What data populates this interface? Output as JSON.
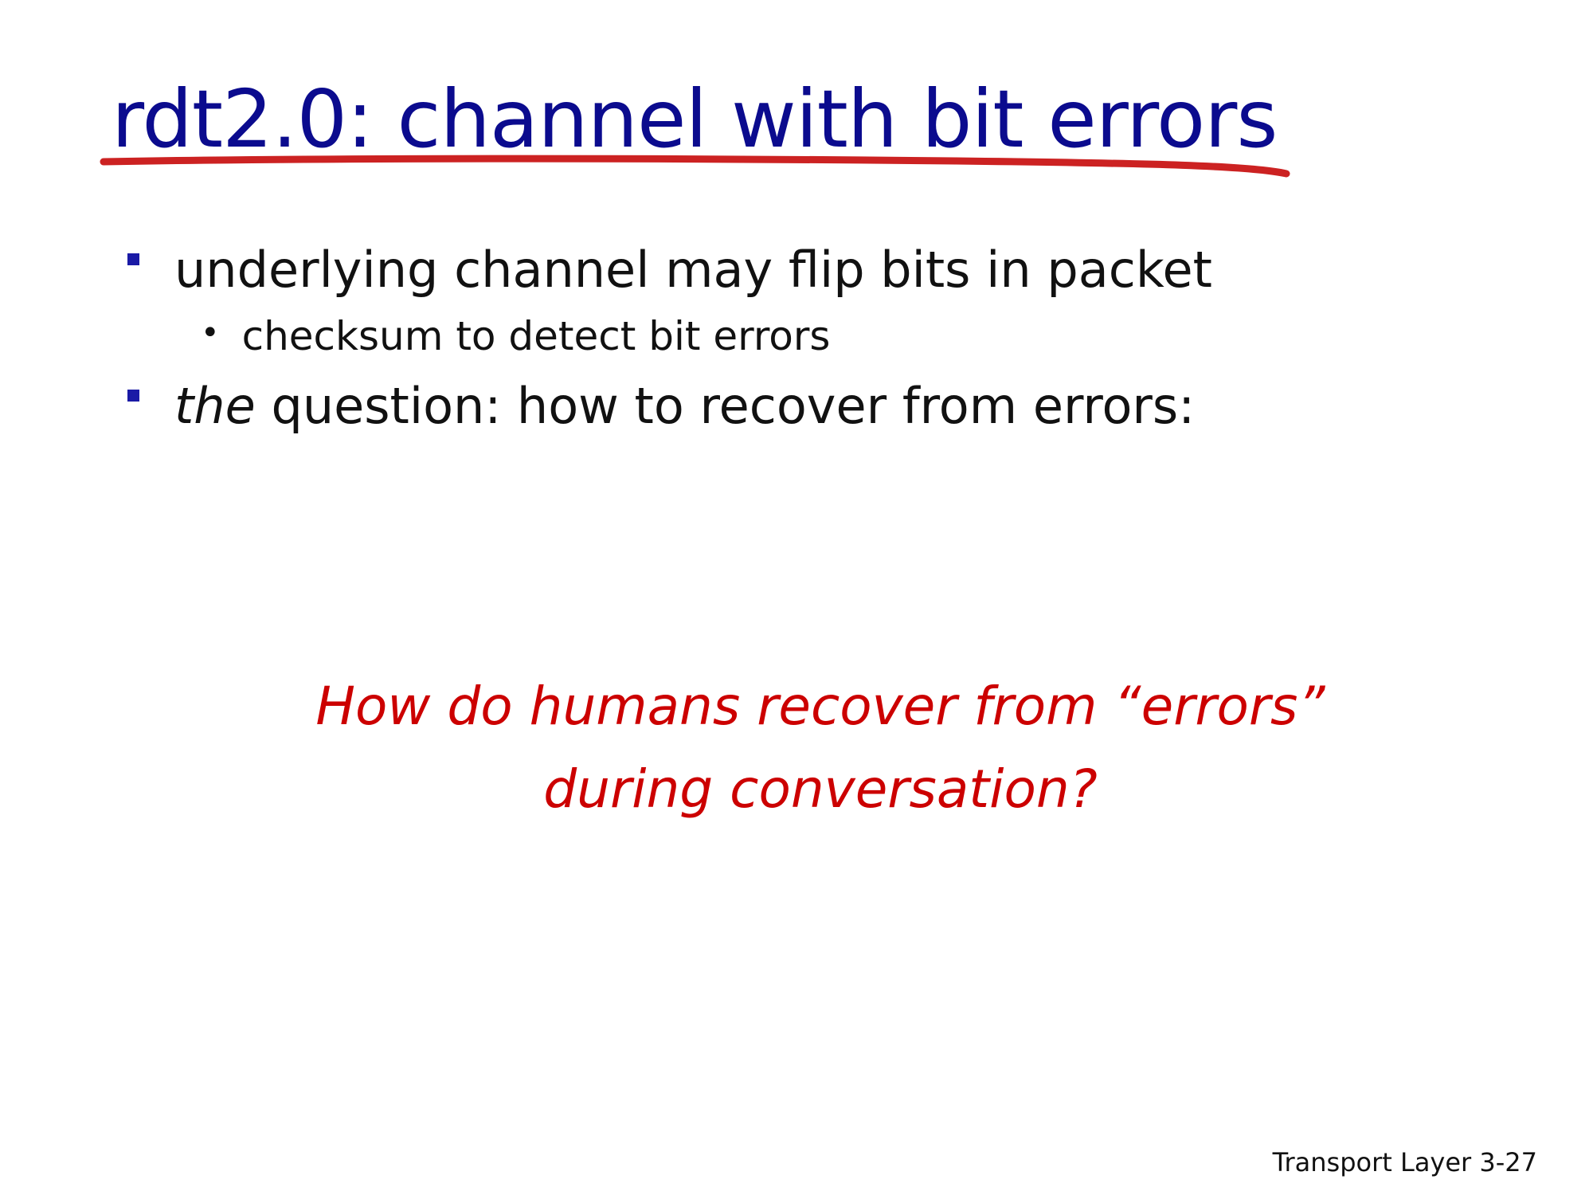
{
  "slide": {
    "title": "rdt2.0: channel with bit errors",
    "bullets": [
      {
        "text": "underlying channel may flip bits in packet"
      },
      {
        "text": "checksum to detect bit errors"
      },
      {
        "prefix": "the",
        "text": " question: how to recover from errors:"
      }
    ],
    "callout": {
      "line1": "How do humans recover from  “errors”",
      "line2": "during conversation?"
    },
    "footer": {
      "section": "Transport  Layer",
      "page": "3-27"
    }
  },
  "colors": {
    "title": "#0b0b8e",
    "underline": "#cc2222",
    "bullet": "#1a1aa6",
    "callout": "#cc0000",
    "text": "#111111"
  }
}
